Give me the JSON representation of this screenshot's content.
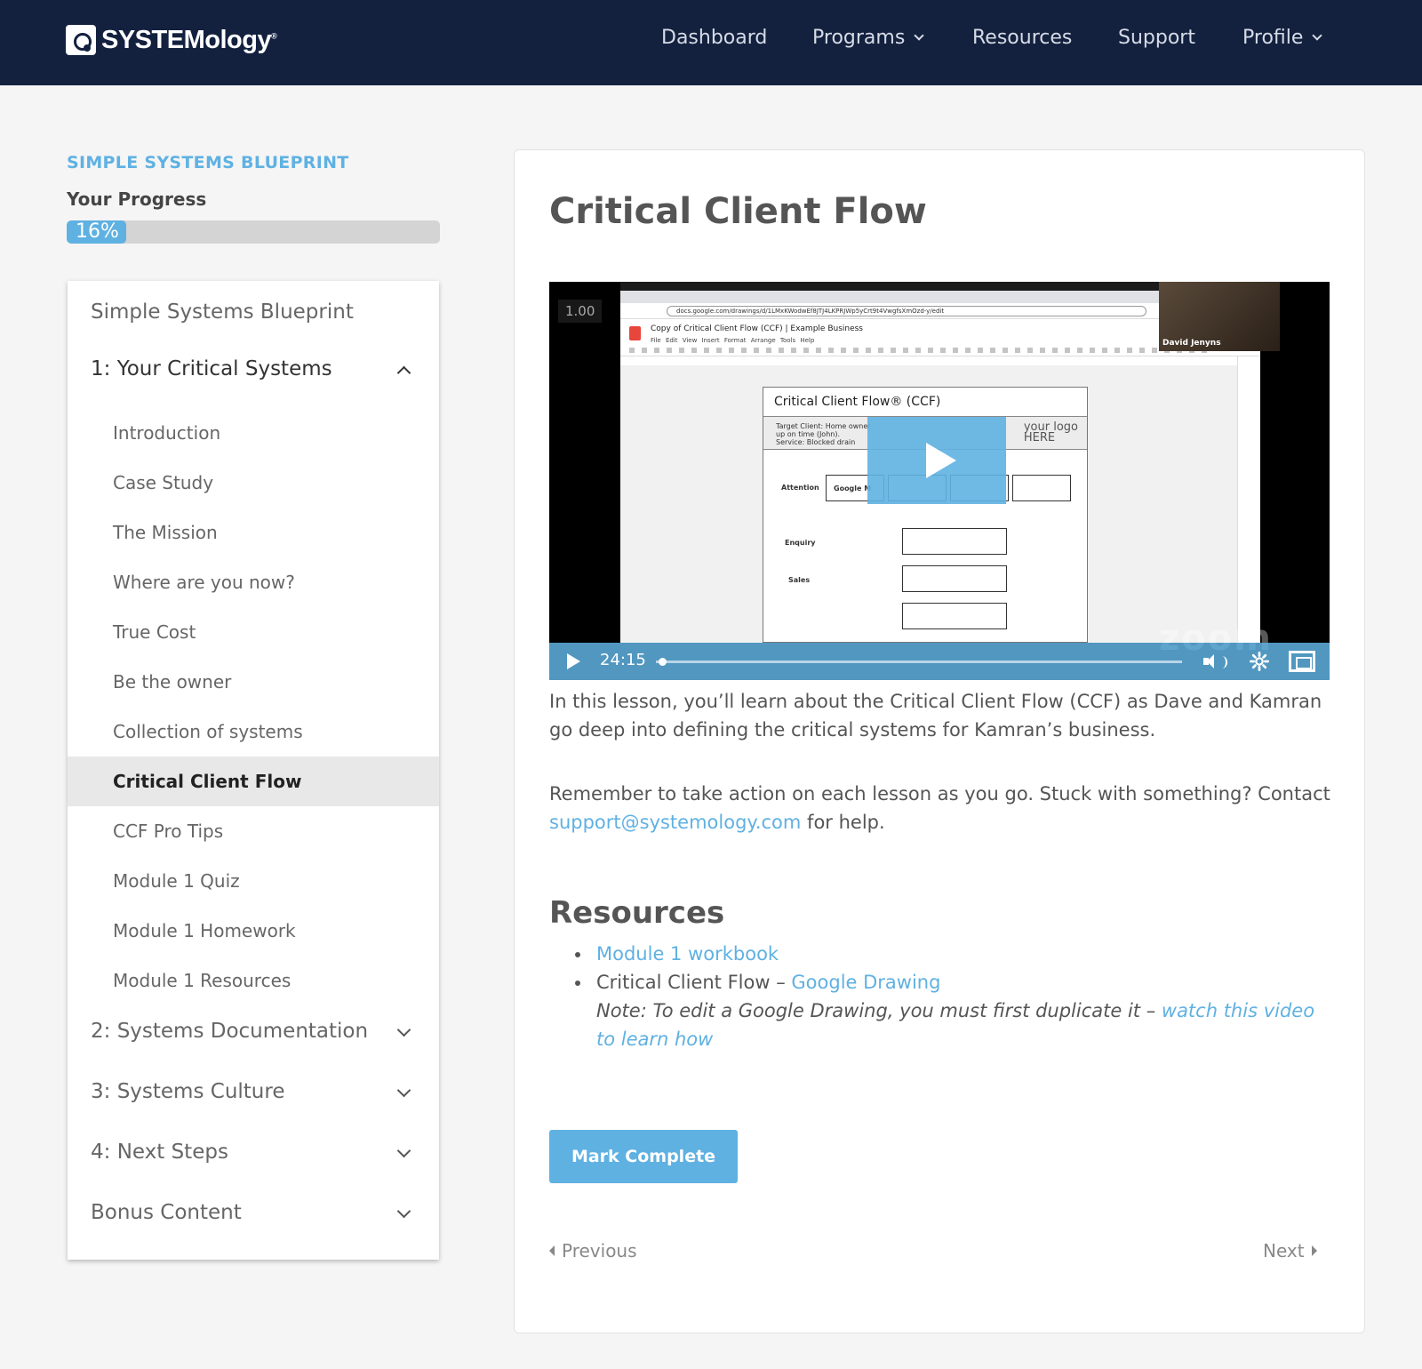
{
  "header": {
    "logo_text": "SYSTEMology",
    "logo_reg": "®",
    "nav": [
      {
        "label": "Dashboard"
      },
      {
        "label": "Programs"
      },
      {
        "label": "Resources"
      },
      {
        "label": "Support"
      },
      {
        "label": "Profile"
      }
    ]
  },
  "sidebar": {
    "course_title": "SIMPLE SYSTEMS BLUEPRINT",
    "progress_label": "Your Progress",
    "progress_percent": 16,
    "progress_text": "16%",
    "menu_top": "Simple Systems Blueprint",
    "modules": [
      {
        "label": "1: Your Critical Systems",
        "expanded": true
      },
      {
        "label": "2: Systems Documentation"
      },
      {
        "label": "3: Systems Culture"
      },
      {
        "label": "4: Next Steps"
      },
      {
        "label": "Bonus Content"
      }
    ],
    "lessons": [
      {
        "label": "Introduction"
      },
      {
        "label": "Case Study"
      },
      {
        "label": "The Mission"
      },
      {
        "label": "Where are you now?"
      },
      {
        "label": "True Cost"
      },
      {
        "label": "Be the owner"
      },
      {
        "label": "Collection of systems"
      },
      {
        "label": "Critical Client Flow",
        "active": true
      },
      {
        "label": "CCF Pro Tips"
      },
      {
        "label": "Module 1 Quiz"
      },
      {
        "label": "Module 1 Homework"
      },
      {
        "label": "Module 1 Resources"
      }
    ]
  },
  "main": {
    "title": "Critical Client Flow",
    "video": {
      "speed": "1.00",
      "time": "24:15",
      "progress_fraction": 0.005,
      "cam_name": "David Jenyns",
      "watermark": "zoom",
      "screen": {
        "url": "docs.google.com/drawings/d/1LMxKWodwEf8JTJ4LKPRJWp5yCrt9t4VwgfsXmOzd-y/edit",
        "doc_title": "Copy of Critical Client Flow (CCF) | Example Business",
        "doc_menu": "File Edit View Insert Format Arrange Tools Help",
        "drawing_title": "Critical Client Flow® (CCF)",
        "target_client": "Target Client: Home owner",
        "target_client_2": "up on time (John).",
        "service": "Service: Blocked drain",
        "logo_line1": "your logo",
        "logo_line2": "HERE",
        "stage_attention": "Attention",
        "stage_enquiry": "Enquiry",
        "stage_sales": "Sales",
        "box_label": "Google M"
      }
    },
    "intro": "In this lesson, you’ll learn about the Critical Client Flow (CCF) as Dave and Kamran go deep into defining the critical systems for Kamran’s business.",
    "reminder_before": "Remember to take action on each lesson as you go. Stuck with something? Contact ",
    "support_email": "support@systemology.com",
    "reminder_after": " for help.",
    "resources_title": "Resources",
    "resources": {
      "item1_link": "Module 1 workbook",
      "item2_text": "Critical Client Flow – ",
      "item2_link": "Google Drawing",
      "note_text": "Note: To edit a Google Drawing, you must first duplicate it – ",
      "note_link": "watch this video to learn how"
    },
    "mark_complete": "Mark Complete",
    "previous": "Previous",
    "next": "Next"
  }
}
